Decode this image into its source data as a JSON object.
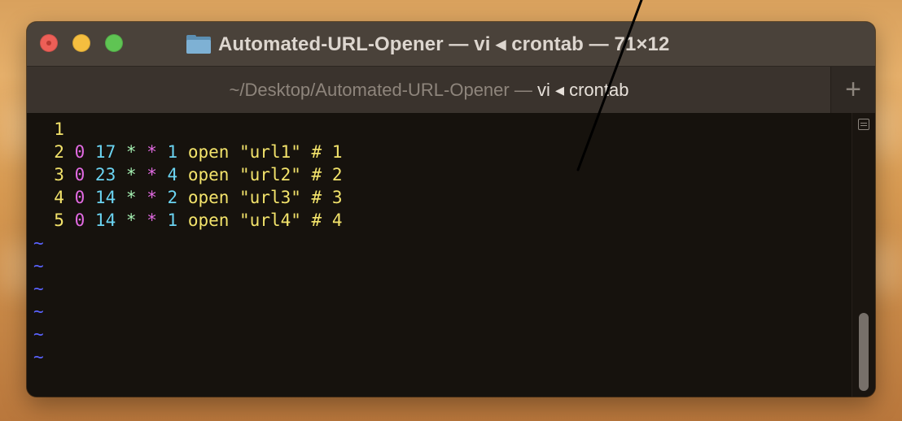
{
  "window": {
    "title": "Automated-URL-Opener — vi ◂ crontab — 71×12"
  },
  "tab": {
    "label_dim": "~/Desktop/Automated-URL-Opener — ",
    "label_bright": "vi ◂ crontab",
    "new_tab": "+"
  },
  "editor": {
    "lines": [
      {
        "n": "1",
        "min": "",
        "hour": "",
        "dom": "",
        "mon": "",
        "dow": "",
        "rest": ""
      },
      {
        "n": "2",
        "min": "0",
        "hour": "17",
        "dom": "*",
        "mon": "*",
        "dow": "1",
        "rest": "open \"url1\" # 1"
      },
      {
        "n": "3",
        "min": "0",
        "hour": "23",
        "dom": "*",
        "mon": "*",
        "dow": "4",
        "rest": "open \"url2\" # 2"
      },
      {
        "n": "4",
        "min": "0",
        "hour": "14",
        "dom": "*",
        "mon": "*",
        "dow": "2",
        "rest": "open \"url3\" # 3"
      },
      {
        "n": "5",
        "min": "0",
        "hour": "14",
        "dom": "*",
        "mon": "*",
        "dow": "1",
        "rest": "open \"url4\" # 4"
      }
    ],
    "empty_marker": "~",
    "empty_rows": 6
  },
  "colors": {
    "line_number": "#f3e36b",
    "zero": "#e26ae2",
    "number": "#6bd4f2",
    "tilde": "#5a63ff"
  }
}
